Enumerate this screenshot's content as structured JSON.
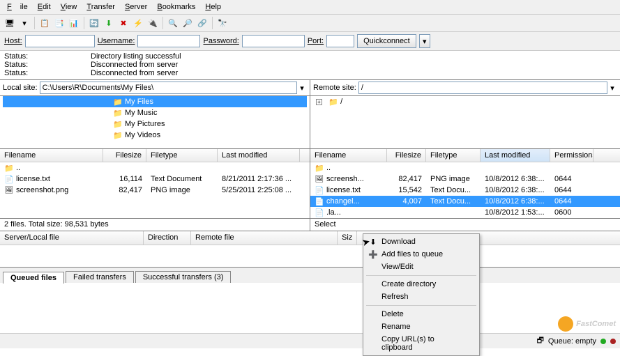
{
  "menu": {
    "file": "File",
    "edit": "Edit",
    "view": "View",
    "transfer": "Transfer",
    "server": "Server",
    "bookmarks": "Bookmarks",
    "help": "Help"
  },
  "quickconnect": {
    "host_lbl": "Host:",
    "user_lbl": "Username:",
    "pass_lbl": "Password:",
    "port_lbl": "Port:",
    "btn": "Quickconnect",
    "host": "",
    "user": "",
    "pass": "",
    "port": ""
  },
  "log": [
    {
      "lbl": "Status:",
      "msg": "Directory listing successful"
    },
    {
      "lbl": "Status:",
      "msg": "Disconnected from server"
    },
    {
      "lbl": "Status:",
      "msg": "Disconnected from server"
    }
  ],
  "local": {
    "site_lbl": "Local site:",
    "path": "C:\\Users\\R\\Documents\\My Files\\",
    "tree": [
      {
        "name": "My Files",
        "sel": true,
        "indent": 158
      },
      {
        "name": "My Music",
        "indent": 158
      },
      {
        "name": "My Pictures",
        "indent": 158
      },
      {
        "name": "My Videos",
        "indent": 158
      }
    ],
    "cols": {
      "name": "Filename",
      "size": "Filesize",
      "type": "Filetype",
      "mod": "Last modified"
    },
    "rows": [
      {
        "name": "..",
        "icon": "folder",
        "size": "",
        "type": "",
        "mod": ""
      },
      {
        "name": "license.txt",
        "icon": "file",
        "size": "16,114",
        "type": "Text Document",
        "mod": "8/21/2011 2:17:36 ..."
      },
      {
        "name": "screenshot.png",
        "icon": "png",
        "size": "82,417",
        "type": "PNG image",
        "mod": "5/25/2011 2:25:08 ..."
      }
    ],
    "status": "2 files. Total size: 98,531 bytes"
  },
  "remote": {
    "site_lbl": "Remote site:",
    "path": "/",
    "tree": [
      {
        "name": "/",
        "indent": 4
      }
    ],
    "cols": {
      "name": "Filename",
      "size": "Filesize",
      "type": "Filetype",
      "mod": "Last modified",
      "perm": "Permissions"
    },
    "rows": [
      {
        "name": "..",
        "icon": "folder",
        "size": "",
        "type": "",
        "mod": "",
        "perm": ""
      },
      {
        "name": "screensh...",
        "icon": "png",
        "size": "82,417",
        "type": "PNG image",
        "mod": "10/8/2012 6:38:...",
        "perm": "0644"
      },
      {
        "name": "license.txt",
        "icon": "file",
        "size": "15,542",
        "type": "Text Docu...",
        "mod": "10/8/2012 6:38:...",
        "perm": "0644"
      },
      {
        "name": "changel...",
        "icon": "file",
        "size": "4,007",
        "type": "Text Docu...",
        "mod": "10/8/2012 6:38:...",
        "perm": "0644",
        "sel": true
      },
      {
        "name": ".la...",
        "icon": "file",
        "size": "",
        "type": "",
        "mod": "10/8/2012 1:53:...",
        "perm": "0600"
      }
    ],
    "status": "Select"
  },
  "queue": {
    "cols": {
      "file": "Server/Local file",
      "dir": "Direction",
      "remote": "Remote file",
      "size": "Siz"
    },
    "tabs": {
      "queued": "Queued files",
      "failed": "Failed transfers",
      "success": "Successful transfers (3)"
    }
  },
  "footer": {
    "queue": "Queue: empty"
  },
  "ctx": {
    "download": "Download",
    "add": "Add files to queue",
    "view": "View/Edit",
    "create": "Create directory",
    "refresh": "Refresh",
    "delete": "Delete",
    "rename": "Rename",
    "copy": "Copy URL(s) to clipboard"
  },
  "watermark": "FastComet"
}
